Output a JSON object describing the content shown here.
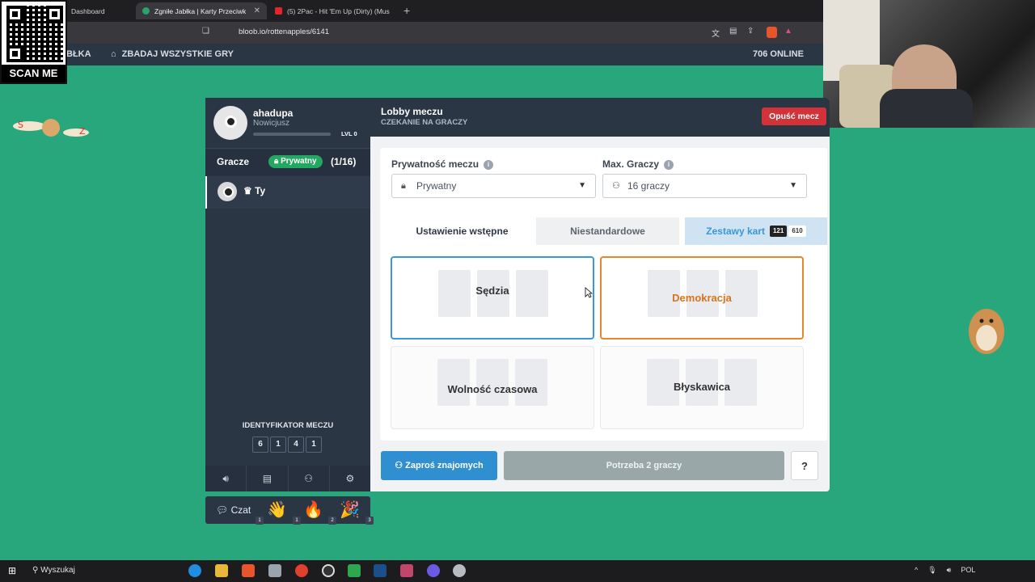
{
  "browser": {
    "tabs": [
      {
        "title": "Dashboard",
        "favicon_color": "#2b2b2b"
      },
      {
        "title": "Zgniłe Jabłka | Karty Przeciwk",
        "favicon_color": "#2aa36a"
      },
      {
        "title": "(5) 2Pac - Hit 'Em Up (Dirty) (Mus",
        "favicon_color": "#e0262b"
      }
    ],
    "new_tab_icon": "plus-icon",
    "url": "bloob.io/rottenapples/6141"
  },
  "qr": {
    "label": "SCAN ME"
  },
  "site_nav": {
    "brand_fragment": "BŁKA",
    "all_games": "ZBADAJ WSZYSTKIE GRY",
    "online": "706 ONLINE"
  },
  "profile": {
    "name": "ahadupa",
    "rank": "Nowicjusz",
    "level": "LVL 0",
    "xp_progress": 0
  },
  "players": {
    "label": "Gracze",
    "privacy_badge": "Prywatny",
    "count": "(1/16)",
    "list": [
      {
        "name": "Ty",
        "icon": "crown-icon"
      }
    ]
  },
  "match_id": {
    "label": "IDENTYFIKATOR MECZU",
    "digits": [
      "6",
      "1",
      "4",
      "1"
    ]
  },
  "left_toolbar": [
    "speaker-icon",
    "rules-icon",
    "players-icon",
    "settings-icon"
  ],
  "chat": {
    "label": "Czat",
    "reactions": [
      {
        "emoji": "👋",
        "count": "1"
      },
      {
        "emoji": "👏",
        "count": "1"
      },
      {
        "emoji": "🔥",
        "count": "2"
      },
      {
        "emoji": "🎉",
        "count": "3"
      }
    ]
  },
  "lobby": {
    "title": "Lobby meczu",
    "subtitle": "CZEKANIE NA GRACZY",
    "leave": "Opuść mecz"
  },
  "settings": {
    "privacy_label": "Prywatność meczu",
    "privacy_value": "Prywatny",
    "max_label": "Max. Graczy",
    "max_value": "16 graczy"
  },
  "tabs": {
    "preset": "Ustawienie wstępne",
    "custom": "Niestandardowe",
    "card_sets": "Zestawy kart",
    "count_a": "121",
    "count_b": "610"
  },
  "presets": [
    {
      "name": "Sędzia",
      "state": "selected"
    },
    {
      "name": "Demokracja",
      "state": "highlighted"
    },
    {
      "name": "Wolność czasowa",
      "state": "dim"
    },
    {
      "name": "Błyskawica",
      "state": "dim"
    }
  ],
  "actions": {
    "invite": "Zaproś znajomych",
    "need": "Potrzeba 2 graczy",
    "help": "?"
  },
  "taskbar": {
    "search": "Wyszukaj",
    "lang": "POL"
  },
  "colors": {
    "background": "#28a77c",
    "panel": "#2b3645",
    "accent_blue": "#2f8fd1",
    "danger": "#d33238",
    "highlight_orange": "#e8862a"
  }
}
